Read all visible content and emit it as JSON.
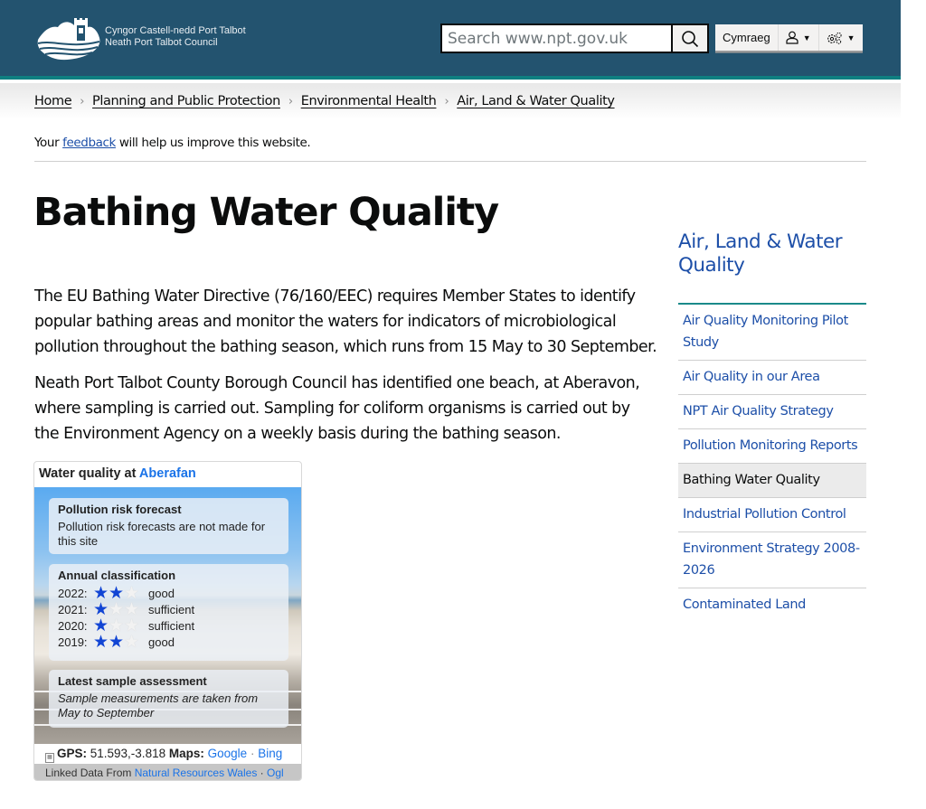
{
  "header": {
    "logo_line1": "Cyngor Castell-nedd Port Talbot",
    "logo_line2": "Neath Port Talbot Council",
    "search_placeholder": "Search www.npt.gov.uk",
    "search_icon": "search-icon",
    "language_button": "Cymraeg",
    "account_icon": "user-icon",
    "settings_icon": "gears-icon",
    "colors": {
      "header_bg": "#23536f",
      "header_accent": "#0f7f81"
    }
  },
  "breadcrumb": [
    {
      "label": "Home"
    },
    {
      "label": "Planning and Public Protection"
    },
    {
      "label": "Environmental Health"
    },
    {
      "label": "Air, Land & Water Quality"
    }
  ],
  "feedback": {
    "prefix": "Your ",
    "link": "feedback",
    "suffix": " will help us improve this website."
  },
  "page": {
    "title": "Bathing Water Quality",
    "paragraphs": [
      "The EU Bathing Water Directive (76/160/EEC) requires Member States to identify popular bathing areas and monitor the waters for indicators of microbiological pollution throughout the bathing season, which runs from 15 May to 30 September.",
      "Neath Port Talbot County Borough Council has identified one beach, at Aberavon, where sampling is carried out. Sampling for coliform organisms is carried out by the Environment Agency on a weekly basis during the bathing season."
    ]
  },
  "sidebar": {
    "title": "Air, Land & Water Quality",
    "items": [
      {
        "label": "Air Quality Monitoring Pilot Study",
        "active": false
      },
      {
        "label": "Air Quality in our Area",
        "active": false
      },
      {
        "label": "NPT Air Quality Strategy",
        "active": false
      },
      {
        "label": "Pollution Monitoring Reports",
        "active": false
      },
      {
        "label": "Bathing Water Quality",
        "active": true
      },
      {
        "label": "Industrial Pollution Control",
        "active": false
      },
      {
        "label": "Environment Strategy 2008-2026",
        "active": false
      },
      {
        "label": "Contaminated Land",
        "active": false
      }
    ]
  },
  "widget": {
    "heading_prefix": "Water quality at ",
    "heading_link": "Aberafan",
    "forecast": {
      "title": "Pollution risk forecast",
      "text": "Pollution risk forecasts are not made for this site"
    },
    "classification": {
      "title": "Annual classification",
      "rows": [
        {
          "year": "2022:",
          "stars": 2,
          "max_stars": 3,
          "label": "good"
        },
        {
          "year": "2021:",
          "stars": 1,
          "max_stars": 3,
          "label": "sufficient"
        },
        {
          "year": "2020:",
          "stars": 1,
          "max_stars": 3,
          "label": "sufficient"
        },
        {
          "year": "2019:",
          "stars": 2,
          "max_stars": 3,
          "label": "good"
        }
      ]
    },
    "sample": {
      "title": "Latest sample assessment",
      "text": "Sample measurements are taken from May to September"
    },
    "gps_label": "GPS:",
    "gps_value": " 51.593,-3.818 ",
    "maps_label": "Maps:",
    "map_links": [
      "Google",
      "Bing"
    ],
    "footer_prefix": "Linked Data From ",
    "footer_links": [
      "Natural Resources Wales",
      "Ogl"
    ],
    "star_color": "#1245d4"
  }
}
